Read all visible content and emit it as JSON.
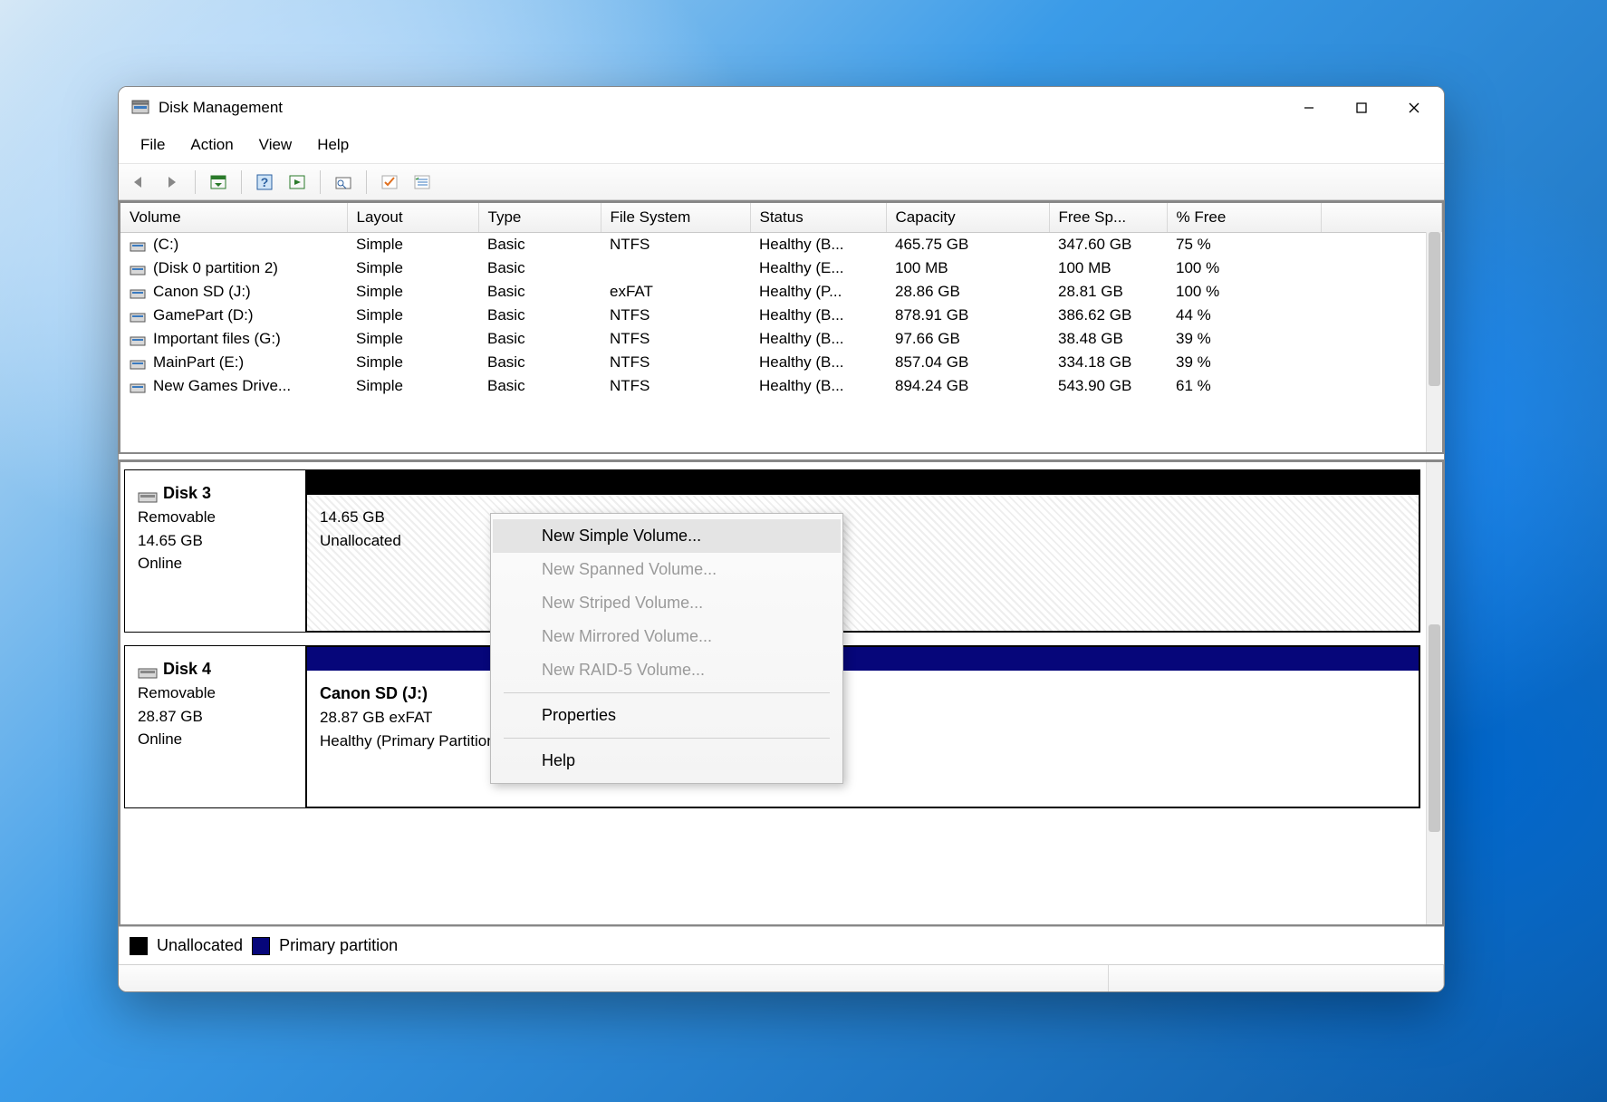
{
  "window": {
    "title": "Disk Management"
  },
  "menu": {
    "items": [
      "File",
      "Action",
      "View",
      "Help"
    ]
  },
  "volumes": {
    "headers": [
      "Volume",
      "Layout",
      "Type",
      "File System",
      "Status",
      "Capacity",
      "Free Sp...",
      "% Free"
    ],
    "rows": [
      {
        "name": "(C:)",
        "layout": "Simple",
        "type": "Basic",
        "fs": "NTFS",
        "status": "Healthy (B...",
        "capacity": "465.75 GB",
        "free": "347.60 GB",
        "pct": "75 %"
      },
      {
        "name": "(Disk 0 partition 2)",
        "layout": "Simple",
        "type": "Basic",
        "fs": "",
        "status": "Healthy (E...",
        "capacity": "100 MB",
        "free": "100 MB",
        "pct": "100 %"
      },
      {
        "name": "Canon SD (J:)",
        "layout": "Simple",
        "type": "Basic",
        "fs": "exFAT",
        "status": "Healthy (P...",
        "capacity": "28.86 GB",
        "free": "28.81 GB",
        "pct": "100 %"
      },
      {
        "name": "GamePart (D:)",
        "layout": "Simple",
        "type": "Basic",
        "fs": "NTFS",
        "status": "Healthy (B...",
        "capacity": "878.91 GB",
        "free": "386.62 GB",
        "pct": "44 %"
      },
      {
        "name": "Important files (G:)",
        "layout": "Simple",
        "type": "Basic",
        "fs": "NTFS",
        "status": "Healthy (B...",
        "capacity": "97.66 GB",
        "free": "38.48 GB",
        "pct": "39 %"
      },
      {
        "name": "MainPart (E:)",
        "layout": "Simple",
        "type": "Basic",
        "fs": "NTFS",
        "status": "Healthy (B...",
        "capacity": "857.04 GB",
        "free": "334.18 GB",
        "pct": "39 %"
      },
      {
        "name": "New Games Drive...",
        "layout": "Simple",
        "type": "Basic",
        "fs": "NTFS",
        "status": "Healthy (B...",
        "capacity": "894.24 GB",
        "free": "543.90 GB",
        "pct": "61 %"
      }
    ]
  },
  "disks": {
    "disk3": {
      "name": "Disk 3",
      "type": "Removable",
      "size": "14.65 GB",
      "state": "Online",
      "partition": {
        "size": "14.65 GB",
        "status": "Unallocated"
      }
    },
    "disk4": {
      "name": "Disk 4",
      "type": "Removable",
      "size": "28.87 GB",
      "state": "Online",
      "partition": {
        "name": "Canon SD  (J:)",
        "desc": "28.87 GB exFAT",
        "status": "Healthy (Primary Partition)"
      }
    }
  },
  "contextMenu": {
    "items": [
      {
        "label": "New Simple Volume...",
        "enabled": true,
        "highlight": true
      },
      {
        "label": "New Spanned Volume...",
        "enabled": false
      },
      {
        "label": "New Striped Volume...",
        "enabled": false
      },
      {
        "label": "New Mirrored Volume...",
        "enabled": false
      },
      {
        "label": "New RAID-5 Volume...",
        "enabled": false
      },
      {
        "sep": true
      },
      {
        "label": "Properties",
        "enabled": true
      },
      {
        "sep": true
      },
      {
        "label": "Help",
        "enabled": true
      }
    ]
  },
  "legend": {
    "unallocated": "Unallocated",
    "primary": "Primary partition"
  }
}
